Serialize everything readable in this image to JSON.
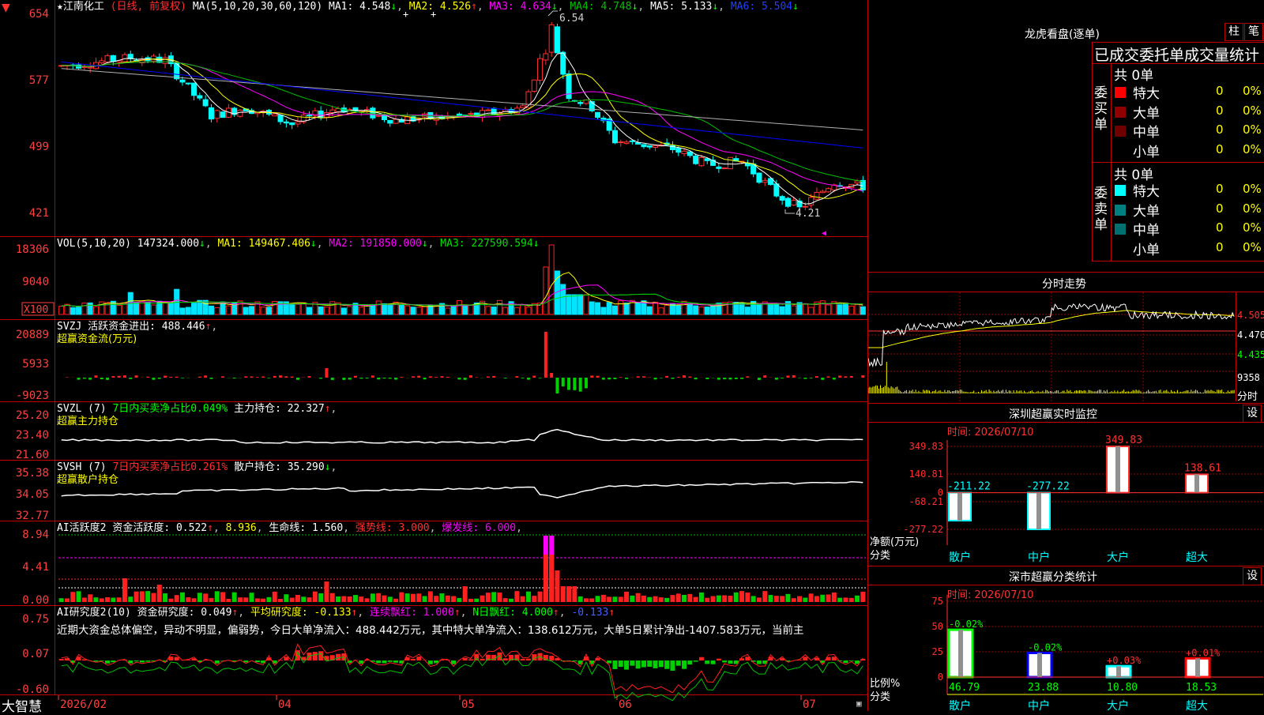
{
  "colors": {
    "up": "#ff3030",
    "down": "#00ffff",
    "vol_up": "#ff2020",
    "vol_down": "#00e5ff",
    "grid": "#a00000",
    "axis": "#ff4040",
    "ma1": "#ffffff",
    "ma2": "#ffff00",
    "ma3": "#ff00ff",
    "ma4": "#00c000",
    "ma5": "#b0b0b0",
    "ma6": "#0000ff"
  },
  "app_logo": "大智慧",
  "main_header": {
    "star": "★",
    "stock_name": "江南化工",
    "mode": "(日线, 前复权)",
    "ma_params": "MA(5,10,20,30,60,120)",
    "ma1": "MA1: 4.548",
    "ma1_arrow": "↓",
    "ma2": "MA2: 4.526",
    "ma2_arrow": "↑",
    "ma3": "MA3: 4.634",
    "ma3_arrow": "↓",
    "ma4": "MA4: 4.748",
    "ma4_arrow": "↓",
    "ma5": "MA5: 5.133",
    "ma5_arrow": "↓",
    "ma6": "MA6: 5.504",
    "ma6_arrow": "↓"
  },
  "price_axis": {
    "ticks": [
      "654",
      "577",
      "499",
      "421"
    ],
    "high_label": "6.54",
    "low_label": "4.21"
  },
  "vol_header": {
    "label": "VOL(5,10,20)",
    "value": "147324.000",
    "v_arrow": "↓",
    "ma1": "MA1: 149467.406",
    "ma1_arrow": "↓",
    "ma2": "MA2: 191850.000",
    "ma2_arrow": "↓",
    "ma3": "MA3: 227590.594",
    "ma3_arrow": "↓"
  },
  "vol_axis": {
    "ticks": [
      "18306",
      "9040"
    ],
    "unit": "X100"
  },
  "svzj_header": {
    "label": "SVZJ",
    "text": "活跃资金进出: 488.446",
    "arrow": "↑",
    "sub": "超赢资金流(万元)"
  },
  "svzj_axis": {
    "ticks": [
      "20889",
      "5933",
      "-9023"
    ]
  },
  "svzl_header": {
    "label": "SVZL (7)",
    "text1": "7日内买卖净占比0.049%",
    "text2": "主力持仓: 22.327",
    "arrow": "↑",
    "sub": "超赢主力持仓"
  },
  "svzl_axis": {
    "ticks": [
      "25.20",
      "23.40",
      "21.60"
    ]
  },
  "svsh_header": {
    "label": "SVSH (7)",
    "text1": "7日内买卖净占比0.261%",
    "text2": "散户持仓: 35.290",
    "arrow": "↓",
    "sub": "超赢散户持仓"
  },
  "svsh_axis": {
    "ticks": [
      "35.38",
      "34.05",
      "32.77"
    ]
  },
  "ai1_header": {
    "label": "AI活跃度2",
    "text1": "资金活跃度: 0.522",
    "a1": "↑",
    "text2": "8.936",
    "text3": "生命线: 1.560",
    "text4": "强势线: 3.000",
    "text5": "爆发线: 6.000"
  },
  "ai1_axis": {
    "ticks": [
      "8.94",
      "4.41",
      "0.00"
    ]
  },
  "ai2_header": {
    "label": "AI研究度2(10)",
    "text1": "资金研究度: 0.049",
    "a1": "↑",
    "text2": "平均研究度: -0.133",
    "a2": "↑",
    "text3": "连续飘红: 1.000",
    "a3": "↑",
    "text4": "N日飘红: 4.000",
    "a4": "↑",
    "text5": "-0.133",
    "a5": "↑"
  },
  "ai2_comment": "近期大资金总体偏空，异动不明显，偏弱势，今日大单净流入：488.442万元，其中特大单净流入：138.612万元，大单5日累计净出-1407.583万元，当前主",
  "ai2_axis": {
    "ticks": [
      "0.75",
      "0.07",
      "-0.60"
    ]
  },
  "date_axis": [
    "2026/02",
    "04",
    "05",
    "06",
    "07"
  ],
  "longhu": {
    "title": "龙虎看盘(逐单)",
    "btn_bar": "柱",
    "btn_line": "笔",
    "subtitle": "已成交委托单成交量统计",
    "buy_side": "委买单",
    "sell_side": "委卖单",
    "buy_total": "共 0单",
    "sell_total": "共 0单",
    "buy_rows": [
      {
        "label": "特大",
        "count": "0",
        "pct": "0%",
        "color": "#ff0000"
      },
      {
        "label": "大单",
        "count": "0",
        "pct": "0%",
        "color": "#900000"
      },
      {
        "label": "中单",
        "count": "0",
        "pct": "0%",
        "color": "#700000"
      },
      {
        "label": "小单",
        "count": "0",
        "pct": "0%",
        "color": "#000000"
      }
    ],
    "sell_rows": [
      {
        "label": "特大",
        "count": "0",
        "pct": "0%",
        "color": "#00ffff"
      },
      {
        "label": "大单",
        "count": "0",
        "pct": "0%",
        "color": "#008080"
      },
      {
        "label": "中单",
        "count": "0",
        "pct": "0%",
        "color": "#007070"
      },
      {
        "label": "小单",
        "count": "0",
        "pct": "0%",
        "color": "#000000"
      }
    ]
  },
  "intraday": {
    "title": "分时走势",
    "price_ticks": [
      "4.505",
      "4.470",
      "4.435"
    ],
    "vol_tick": "9358",
    "footer": "分时"
  },
  "monitor": {
    "title": "深圳超赢实时监控",
    "btn": "设",
    "time": "时间: 2026/07/10",
    "yticks": [
      "349.83",
      "140.81",
      "0",
      "-68.21",
      "-277.22"
    ],
    "ylabel1": "净额(万元)",
    "ylabel2": "分类",
    "categories": [
      "散户",
      "中户",
      "大户",
      "超大"
    ],
    "values": [
      -211.22,
      -277.22,
      349.83,
      138.61
    ],
    "value_labels": [
      "-211.22",
      "-277.22",
      "349.83",
      "138.61"
    ]
  },
  "classify": {
    "title": "深市超赢分类统计",
    "btn": "设",
    "time": "时间: 2026/07/10",
    "yticks": [
      "75",
      "50",
      "25",
      "0"
    ],
    "ylabel1": "比例%",
    "ylabel2": "分类",
    "categories": [
      "散户",
      "中户",
      "大户",
      "超大"
    ],
    "values": [
      46.79,
      23.88,
      10.8,
      18.53
    ],
    "value_labels": [
      "46.79",
      "23.88",
      "10.80",
      "18.53"
    ],
    "change_labels": [
      "-0.02%",
      "-0.02%",
      "+0.03%",
      "+0.01%"
    ]
  }
}
